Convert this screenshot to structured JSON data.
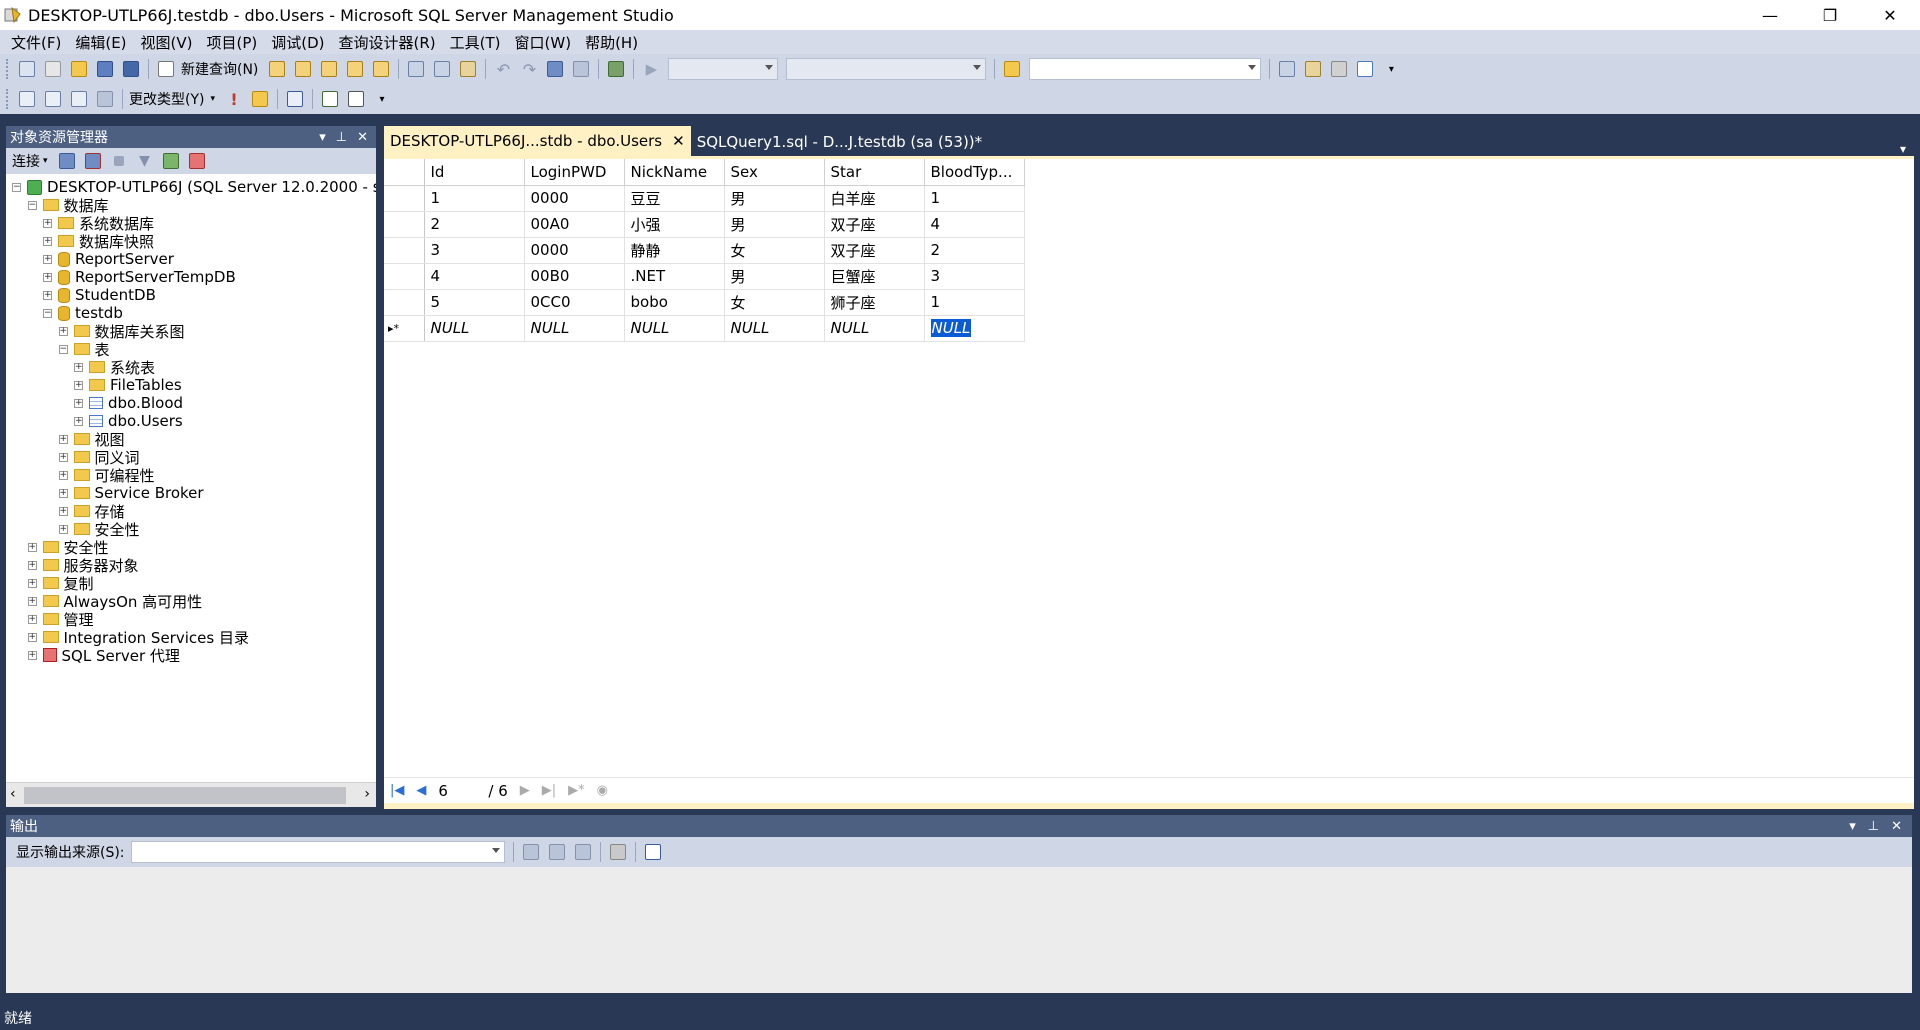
{
  "window": {
    "title": "DESKTOP-UTLP66J.testdb - dbo.Users - Microsoft SQL Server Management Studio",
    "minimize": "—",
    "restore": "❐",
    "close": "✕"
  },
  "menu": [
    "文件(F)",
    "编辑(E)",
    "视图(V)",
    "项目(P)",
    "调试(D)",
    "查询设计器(R)",
    "工具(T)",
    "窗口(W)",
    "帮助(H)"
  ],
  "toolbar1": {
    "new_query": "新建查询(N)"
  },
  "toolbar2": {
    "change_type": "更改类型(Y)"
  },
  "object_explorer": {
    "title": "对象资源管理器",
    "connect": "连接",
    "tree": [
      {
        "label": "DESKTOP-UTLP66J (SQL Server 12.0.2000 - s",
        "level": 0,
        "icon": "server-icon",
        "state": "expanded"
      },
      {
        "label": "数据库",
        "level": 1,
        "icon": "folder-icon",
        "state": "expanded"
      },
      {
        "label": "系统数据库",
        "level": 2,
        "icon": "folder-icon",
        "state": "collapsed"
      },
      {
        "label": "数据库快照",
        "level": 2,
        "icon": "folder-icon",
        "state": "collapsed"
      },
      {
        "label": "ReportServer",
        "level": 2,
        "icon": "database-icon",
        "state": "collapsed"
      },
      {
        "label": "ReportServerTempDB",
        "level": 2,
        "icon": "database-icon",
        "state": "collapsed"
      },
      {
        "label": "StudentDB",
        "level": 2,
        "icon": "database-icon",
        "state": "collapsed"
      },
      {
        "label": "testdb",
        "level": 2,
        "icon": "database-icon",
        "state": "expanded"
      },
      {
        "label": "数据库关系图",
        "level": 3,
        "icon": "folder-icon",
        "state": "collapsed"
      },
      {
        "label": "表",
        "level": 3,
        "icon": "folder-icon",
        "state": "expanded"
      },
      {
        "label": "系统表",
        "level": 4,
        "icon": "folder-icon",
        "state": "collapsed"
      },
      {
        "label": "FileTables",
        "level": 4,
        "icon": "folder-icon",
        "state": "collapsed"
      },
      {
        "label": "dbo.Blood",
        "level": 4,
        "icon": "table-icon",
        "state": "collapsed"
      },
      {
        "label": "dbo.Users",
        "level": 4,
        "icon": "table-icon",
        "state": "collapsed"
      },
      {
        "label": "视图",
        "level": 3,
        "icon": "folder-icon",
        "state": "collapsed"
      },
      {
        "label": "同义词",
        "level": 3,
        "icon": "folder-icon",
        "state": "collapsed"
      },
      {
        "label": "可编程性",
        "level": 3,
        "icon": "folder-icon",
        "state": "collapsed"
      },
      {
        "label": "Service Broker",
        "level": 3,
        "icon": "folder-icon",
        "state": "collapsed"
      },
      {
        "label": "存储",
        "level": 3,
        "icon": "folder-icon",
        "state": "collapsed"
      },
      {
        "label": "安全性",
        "level": 3,
        "icon": "folder-icon",
        "state": "collapsed"
      },
      {
        "label": "安全性",
        "level": 1,
        "icon": "folder-icon",
        "state": "collapsed"
      },
      {
        "label": "服务器对象",
        "level": 1,
        "icon": "folder-icon",
        "state": "collapsed"
      },
      {
        "label": "复制",
        "level": 1,
        "icon": "folder-icon",
        "state": "collapsed"
      },
      {
        "label": "AlwaysOn 高可用性",
        "level": 1,
        "icon": "folder-icon",
        "state": "collapsed"
      },
      {
        "label": "管理",
        "level": 1,
        "icon": "folder-icon",
        "state": "collapsed"
      },
      {
        "label": "Integration Services 目录",
        "level": 1,
        "icon": "folder-icon",
        "state": "collapsed"
      },
      {
        "label": "SQL Server 代理",
        "level": 1,
        "icon": "agent-icon",
        "state": "collapsed"
      }
    ]
  },
  "tabs": [
    {
      "label": "DESKTOP-UTLP66J...stdb - dbo.Users",
      "active": true,
      "close": "✕"
    },
    {
      "label": "SQLQuery1.sql - D...J.testdb (sa (53))*",
      "active": false
    }
  ],
  "grid": {
    "columns": [
      "Id",
      "LoginPWD",
      "NickName",
      "Sex",
      "Star",
      "BloodTyp..."
    ],
    "rows": [
      [
        "1",
        "0000",
        "豆豆",
        "男",
        "白羊座",
        "1"
      ],
      [
        "2",
        "00A0",
        "小强",
        "男",
        "双子座",
        "4"
      ],
      [
        "3",
        "0000",
        "静静",
        "女",
        "双子座",
        "2"
      ],
      [
        "4",
        "00B0",
        ".NET",
        "男",
        "巨蟹座",
        "3"
      ],
      [
        "5",
        "0CC0",
        "bobo",
        "女",
        "狮子座",
        "1"
      ]
    ],
    "new_row_marker": "▸*",
    "new_row": [
      "NULL",
      "NULL",
      "NULL",
      "NULL",
      "NULL",
      "NULL"
    ]
  },
  "pager": {
    "current": "6",
    "total": "/ 6"
  },
  "output": {
    "title": "输出",
    "source_label": "显示输出来源(S):",
    "source_value": ""
  },
  "status": {
    "text": "就绪"
  },
  "colors": {
    "chrome": "#293955",
    "panel_header": "#4d6082",
    "active_tab": "#fff1c4",
    "selection": "#0b5bd5"
  }
}
